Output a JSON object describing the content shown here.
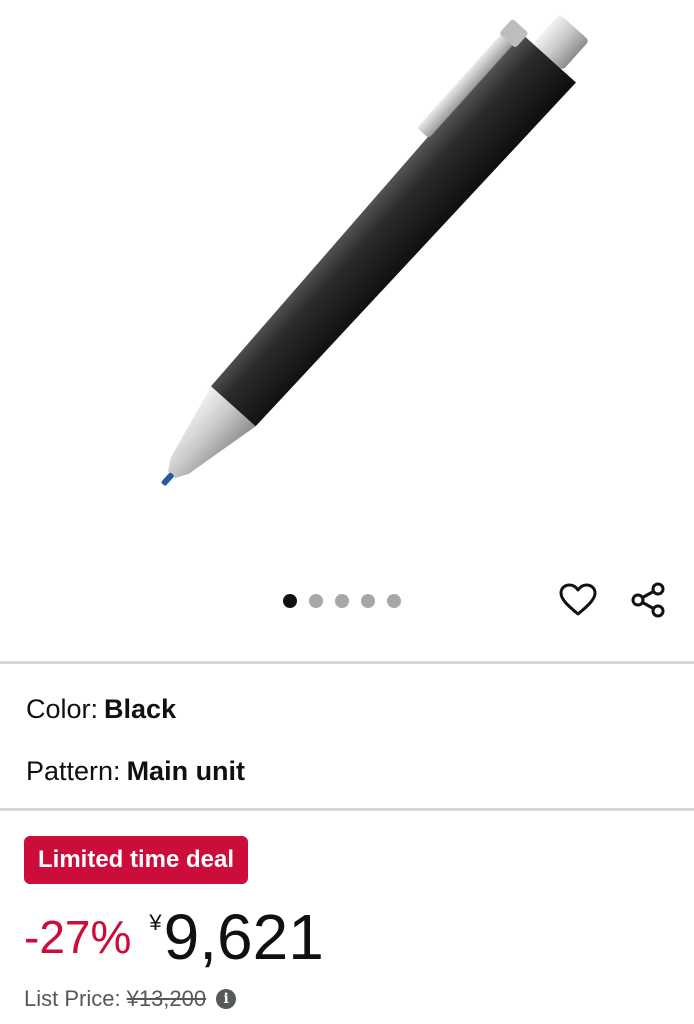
{
  "gallery": {
    "image_alt": "Black mechanical pen with brushed steel tip, clip and push button",
    "total_images": 5,
    "active_index": 0
  },
  "icons": {
    "wishlist": "heart-outline-icon",
    "share": "share-icon",
    "info": "info-icon"
  },
  "variations": [
    {
      "label": "Color:",
      "value": "Black"
    },
    {
      "label": "Pattern:",
      "value": "Main unit"
    }
  ],
  "deal": {
    "badge": "Limited time deal"
  },
  "price": {
    "discount": "-27%",
    "currency": "¥",
    "amount": "9,621",
    "list_price_label": "List Price:",
    "list_price_value": "¥13,200",
    "info_glyph": "i"
  },
  "colors": {
    "deal_red": "#cc0c39",
    "text": "#0f1111",
    "muted": "#565959",
    "divider": "#d5d9d9"
  }
}
